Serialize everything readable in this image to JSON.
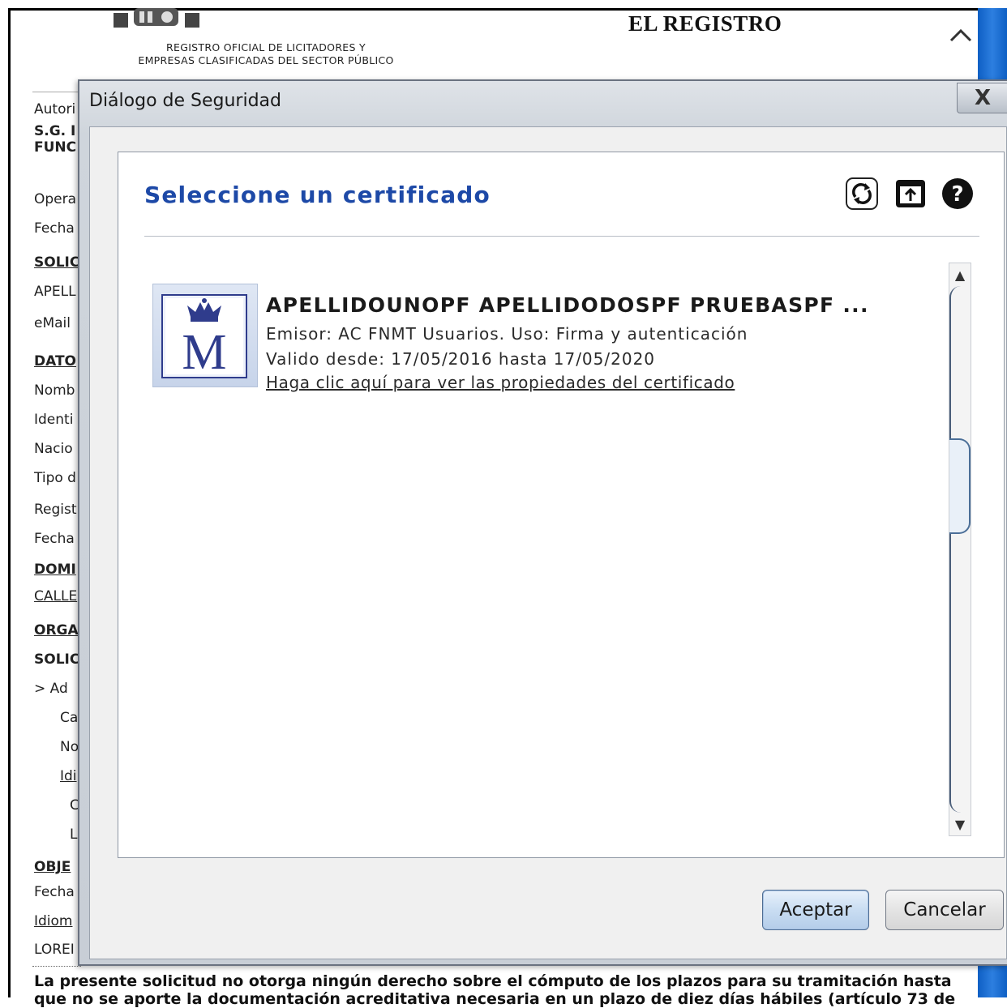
{
  "background": {
    "header": {
      "line1": "REGISTRO OFICIAL DE LICITADORES Y",
      "line2": "EMPRESAS CLASIFICADAS DEL SECTOR PÚBLICO",
      "title": "EL REGISTRO"
    },
    "labels": [
      "Autori",
      "S.G. I",
      "FUNC",
      "Opera",
      "Fecha",
      "SOLIC",
      "APELL",
      "eMail",
      "DATO",
      "Nomb",
      "Identi",
      "Nacio",
      "Tipo d",
      "Regist",
      "Fecha",
      "DOMI",
      "CALLE",
      "ORGA",
      "SOLIC",
      ">  Ad",
      "Ca",
      "No",
      "Idi",
      "C",
      "L",
      "OBJE",
      "Fecha",
      "Idiom",
      "LOREI"
    ],
    "footer": "La presente solicitud no otorga ningún derecho sobre el cómputo de los plazos para su tramitación hasta que no se aporte la documentación acreditativa necesaria en un plazo de diez días hábiles (artículo 73 de"
  },
  "dialog": {
    "title": "Diálogo de Seguridad",
    "close_label": "X",
    "heading": "Seleccione un certificado",
    "toolbar": {
      "refresh_icon": "refresh-icon",
      "export_icon": "export-icon",
      "help_icon": "help-icon"
    },
    "certificate": {
      "name": "APELLIDOUNOPF APELLIDODOSPF PRUEBASPF ...",
      "issuer": "Emisor: AC FNMT Usuarios. Uso: Firma y autenticación",
      "validity": "Valido desde: 17/05/2016 hasta 17/05/2020",
      "link": "Haga clic aquí para ver las propiedades del certificado",
      "logo_letter": "M"
    },
    "scrollbar": {
      "up": "▲",
      "down": "▼"
    },
    "buttons": {
      "ok": "Aceptar",
      "cancel": "Cancelar"
    },
    "colors": {
      "heading": "#1d49a7",
      "primary_button": "#c9ddf2"
    }
  }
}
